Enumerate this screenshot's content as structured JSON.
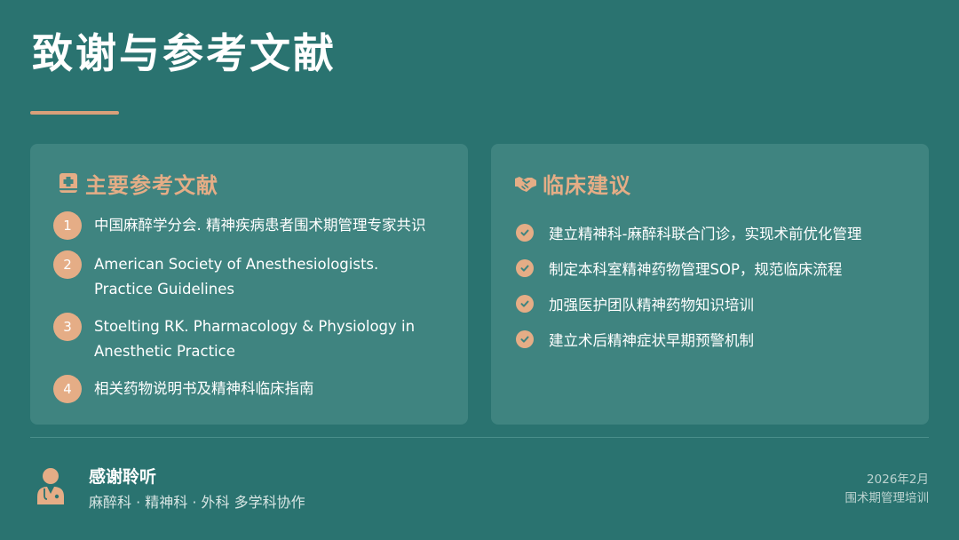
{
  "title": "致谢与参考文献",
  "colors": {
    "background": "#2a7370",
    "card": "#3f8480",
    "accent": "#e5ad86"
  },
  "references": {
    "heading": "主要参考文献",
    "icon": "book-medical-icon",
    "items": [
      {
        "num": "1",
        "text": "中国麻醉学分会. 精神疾病患者围术期管理专家共识"
      },
      {
        "num": "2",
        "text": "American Society of Anesthesiologists. Practice Guidelines"
      },
      {
        "num": "3",
        "text": "Stoelting RK. Pharmacology & Physiology in Anesthetic Practice"
      },
      {
        "num": "4",
        "text": "相关药物说明书及精神科临床指南"
      }
    ]
  },
  "suggestions": {
    "heading": "临床建议",
    "icon": "handshake-icon",
    "items": [
      {
        "text": "建立精神科-麻醉科联合门诊，实现术前优化管理"
      },
      {
        "text": "制定本科室精神药物管理SOP，规范临床流程"
      },
      {
        "text": "加强医护团队精神药物知识培训"
      },
      {
        "text": "建立术后精神症状早期预警机制"
      }
    ]
  },
  "footer": {
    "thanks": "感谢聆听",
    "departments": "麻醉科 · 精神科 · 外科 多学科协作",
    "date": "2026年2月",
    "training": "围术期管理培训",
    "icon": "doctor-avatar-icon"
  }
}
